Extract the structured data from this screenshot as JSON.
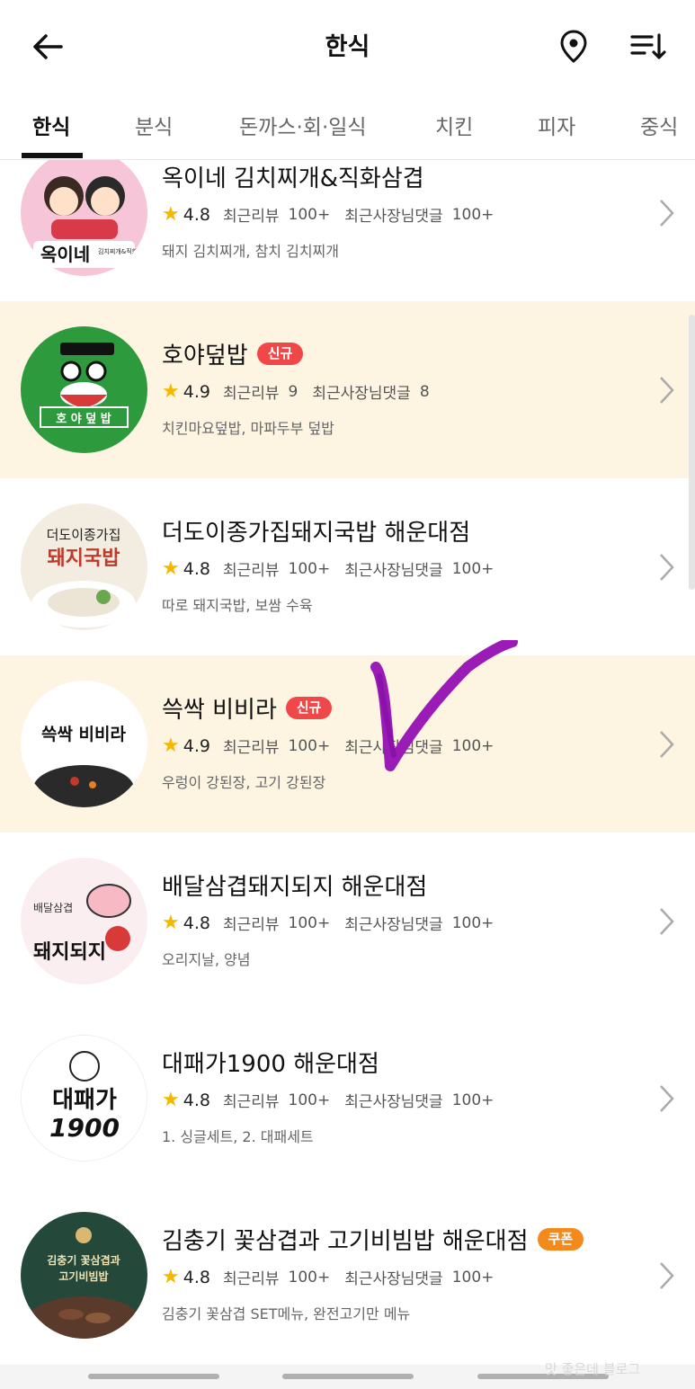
{
  "header": {
    "title": "한식"
  },
  "tabs": [
    {
      "label": "한식"
    },
    {
      "label": "분식"
    },
    {
      "label": "돈까스·회·일식"
    },
    {
      "label": "치킨"
    },
    {
      "label": "피자"
    },
    {
      "label": "중식"
    }
  ],
  "stats_labels": {
    "review": "최근리뷰",
    "owner": "최근사장님댓글"
  },
  "restaurants": [
    {
      "name": "옥이네 김치찌개&직화삼겹",
      "rating": "4.8",
      "review": "100+",
      "owner": "100+",
      "menu": "돼지 김치찌개, 참치 김치찌개",
      "thumb_text": "옥이네",
      "thumb_sub": "김치찌개&직화삼겹"
    },
    {
      "name": "호야덮밥",
      "badge": "신규",
      "rating": "4.9",
      "review": "9",
      "owner": "8",
      "menu": "치킨마요덮밥, 마파두부 덮밥",
      "thumb_text": "호 야 덮 밥"
    },
    {
      "name": "더도이종가집돼지국밥 해운대점",
      "rating": "4.8",
      "review": "100+",
      "owner": "100+",
      "menu": "따로 돼지국밥, 보쌈 수육",
      "thumb_text": "더도이종가집",
      "thumb_sub": "돼지국밥"
    },
    {
      "name": "쓱싹 비비라",
      "badge": "신규",
      "rating": "4.9",
      "review": "100+",
      "owner": "100+",
      "menu": "우렁이 강된장, 고기 강된장",
      "thumb_text": "쓱싹 비비라"
    },
    {
      "name": "배달삼겹돼지되지 해운대점",
      "rating": "4.8",
      "review": "100+",
      "owner": "100+",
      "menu": "오리지날, 양념",
      "thumb_text": "돼지되지",
      "thumb_sub": "배달삼겹"
    },
    {
      "name": "대패가1900 해운대점",
      "rating": "4.8",
      "review": "100+",
      "owner": "100+",
      "menu": "1. 싱글세트, 2. 대패세트",
      "thumb_text": "대패가",
      "thumb_sub": "1900"
    },
    {
      "name": "김충기 꽃삼겹과 고기비빔밥 해운대점",
      "badge": "쿠폰",
      "rating": "4.8",
      "review": "100+",
      "owner": "100+",
      "menu": "김충기 꽃삼겹 SET메뉴, 완전고기만 메뉴",
      "thumb_text": "김충기 꽃삼겹과",
      "thumb_sub": "고기비빔밥"
    }
  ],
  "watermark": "맛 좋은데 블로그",
  "colors": {
    "star": "#f5b800",
    "badge_new": "#f04848",
    "badge_coupon": "#f48a1e",
    "highlight_row": "#fdf4e2",
    "checkmark": "#9a1bb5"
  }
}
